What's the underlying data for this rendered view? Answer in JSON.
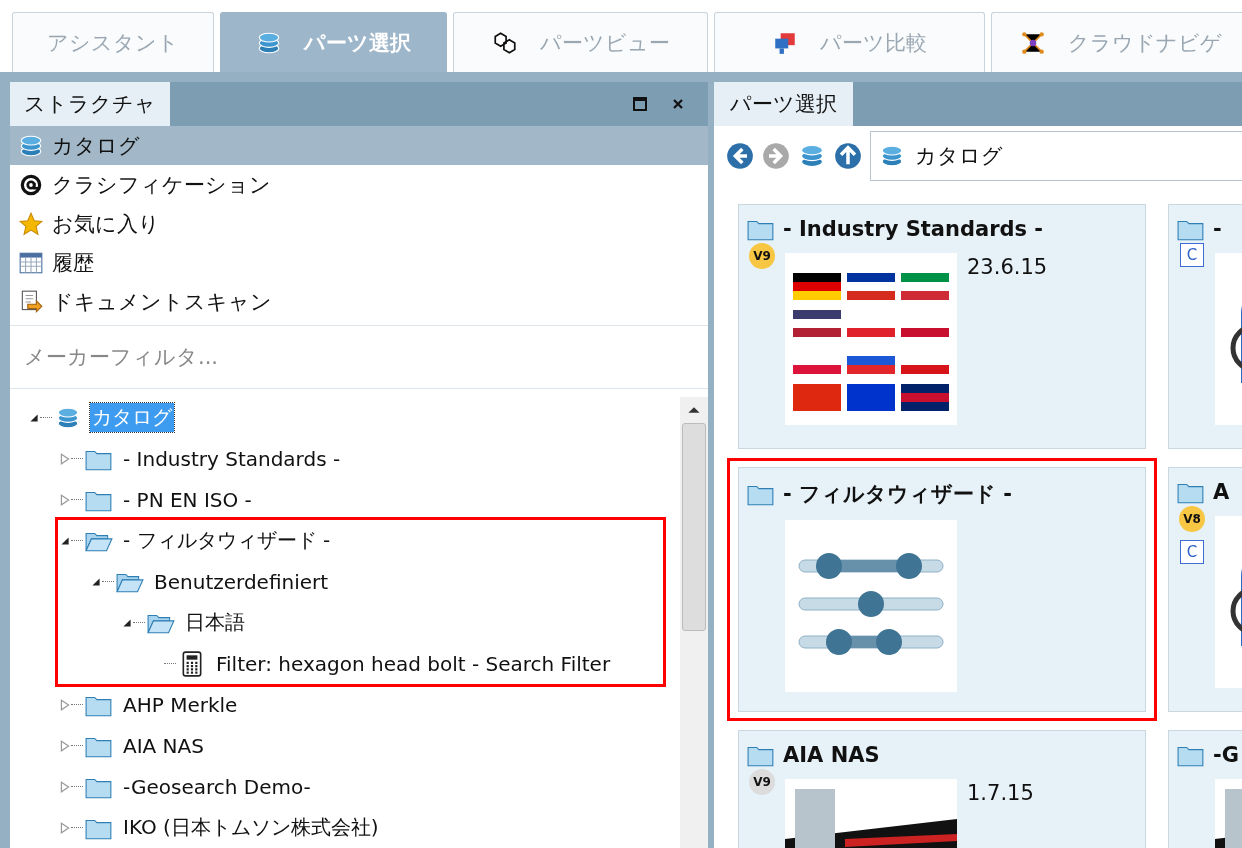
{
  "tabs": [
    {
      "label": "アシスタント",
      "kind": "none",
      "selected": false
    },
    {
      "label": "パーツ選択",
      "kind": "catalog",
      "selected": true
    },
    {
      "label": "パーツビュー",
      "kind": "cubes",
      "selected": false
    },
    {
      "label": "パーツ比較",
      "kind": "compare",
      "selected": false
    },
    {
      "label": "クラウドナビゲ",
      "kind": "network",
      "selected": false
    }
  ],
  "structure_panel": {
    "title": "ストラクチャ",
    "nav_items": [
      {
        "label": "カタログ",
        "kind": "catalog",
        "selected": true
      },
      {
        "label": "クラシフィケーション",
        "kind": "at",
        "selected": false
      },
      {
        "label": "お気に入り",
        "kind": "star",
        "selected": false
      },
      {
        "label": "履歴",
        "kind": "calendar",
        "selected": false
      },
      {
        "label": "ドキュメントスキャン",
        "kind": "scan",
        "selected": false
      }
    ],
    "filter": {
      "placeholder": "メーカーフィルタ..."
    },
    "tree": [
      {
        "label": "カタログ",
        "kind": "catalog",
        "expanded": true,
        "selected": true,
        "children": [
          {
            "label": "- Industry Standards -",
            "kind": "folder",
            "expanded": false,
            "selected": false
          },
          {
            "label": "- PN EN ISO -",
            "kind": "folder",
            "expanded": false,
            "selected": false
          },
          {
            "label": "- フィルタウィザード -",
            "kind": "folder",
            "expanded": true,
            "selected": false,
            "highlighted": true,
            "children": [
              {
                "label": "Benutzerdefiniert",
                "kind": "folder",
                "expanded": true,
                "selected": false,
                "children": [
                  {
                    "label": "日本語",
                    "kind": "folder",
                    "expanded": true,
                    "selected": false,
                    "children": [
                      {
                        "label": "Filter: hexagon head bolt - Search Filter",
                        "kind": "filter",
                        "selected": false
                      }
                    ]
                  }
                ]
              }
            ]
          },
          {
            "label": "AHP Merkle",
            "kind": "folder",
            "expanded": false,
            "selected": false
          },
          {
            "label": "AIA NAS",
            "kind": "folder",
            "expanded": false,
            "selected": false
          },
          {
            "label": "-Geosearch Demo-",
            "kind": "folder",
            "expanded": false,
            "selected": false
          },
          {
            "label": "IKO (日本トムソン株式会社)",
            "kind": "folder",
            "expanded": false,
            "selected": false
          }
        ]
      }
    ]
  },
  "parts_panel": {
    "title": "パーツ選択",
    "breadcrumb": "カタログ",
    "cards": [
      {
        "title": "- Industry Standards -",
        "version": {
          "text": "V9",
          "color": "#f7c744"
        },
        "date": "23.6.15",
        "kind": "flags",
        "highlighted": false
      },
      {
        "title": "-",
        "class_badge": "C",
        "kind": "logo",
        "highlighted": false
      },
      {
        "title": "- フィルタウィザード -",
        "kind": "sliders",
        "highlighted": true
      },
      {
        "title": "A",
        "version": {
          "text": "V8",
          "color": "#f7c744"
        },
        "class_badge": "C",
        "kind": "logo",
        "highlighted": false
      },
      {
        "title": "AIA NAS",
        "version": {
          "text": "V9",
          "color": "#dcdcdc"
        },
        "date": "1.7.15",
        "kind": "picture",
        "highlighted": false
      },
      {
        "title": "-G",
        "kind": "picture",
        "highlighted": false
      }
    ]
  }
}
